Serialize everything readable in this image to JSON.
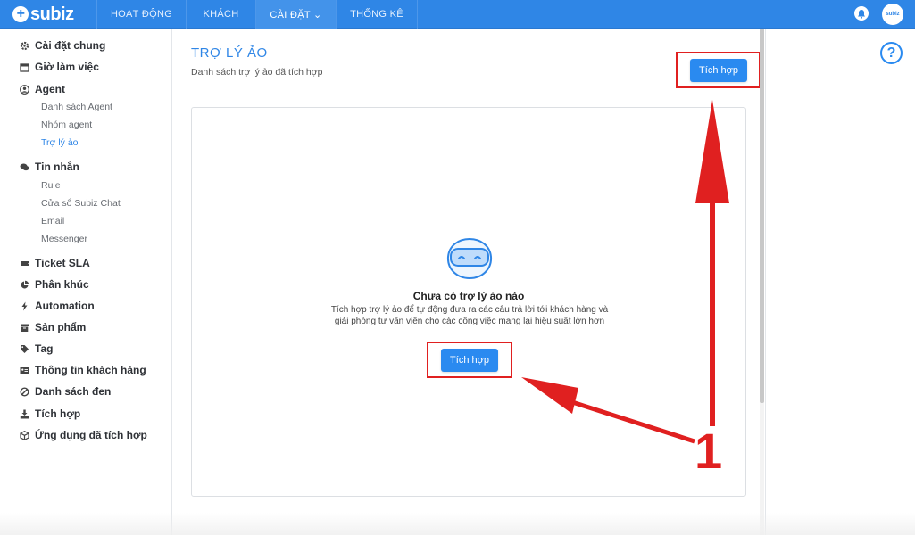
{
  "topbar": {
    "logo_text": "subiz",
    "logo_mark": "+",
    "tabs": [
      {
        "label": "HOẠT ĐỘNG"
      },
      {
        "label": "KHÁCH"
      },
      {
        "label": "CÀI ĐẶT ⌄"
      },
      {
        "label": "THỐNG KÊ"
      }
    ],
    "avatar_text": "subiz",
    "bell_icon": "bell-icon"
  },
  "sidebar": {
    "items": [
      {
        "label": "Cài đặt chung",
        "icon": "gear-icon"
      },
      {
        "label": "Giờ làm việc",
        "icon": "calendar-icon"
      },
      {
        "label": "Agent",
        "icon": "user-circle-icon"
      },
      {
        "label": "Tin nhắn",
        "icon": "chat-icon"
      },
      {
        "label": "Ticket SLA",
        "icon": "ticket-icon"
      },
      {
        "label": "Phân khúc",
        "icon": "pie-chart-icon"
      },
      {
        "label": "Automation",
        "icon": "bolt-icon"
      },
      {
        "label": "Sản phẩm",
        "icon": "box-icon"
      },
      {
        "label": "Tag",
        "icon": "tag-icon"
      },
      {
        "label": "Thông tin khách hàng",
        "icon": "id-card-icon"
      },
      {
        "label": "Danh sách đen",
        "icon": "ban-icon"
      },
      {
        "label": "Tích hợp",
        "icon": "download-icon"
      },
      {
        "label": "Ứng dụng đã tích hợp",
        "icon": "cube-icon"
      }
    ],
    "agent_sub": [
      "Danh sách Agent",
      "Nhóm agent",
      "Trợ lý ảo"
    ],
    "message_sub": [
      "Rule",
      "Cửa sổ Subiz Chat",
      "Email",
      "Messenger"
    ]
  },
  "main": {
    "title": "TRỢ LÝ ẢO",
    "subtitle": "Danh sách trợ lý ảo đã tích hợp",
    "integrate_button": "Tích hợp",
    "empty_state": {
      "title": "Chưa có trợ lý ảo nào",
      "description": "Tích hợp trợ lý ảo để tự động đưa ra các câu trả lời tới khách hàng và giải phóng tư vấn viên cho các công việc mang lại hiệu suất lớn hơn",
      "button": "Tích hợp"
    }
  },
  "annotation": {
    "number": "1"
  },
  "colors": {
    "primary": "#2f86e6",
    "annotation": "#e02020"
  }
}
